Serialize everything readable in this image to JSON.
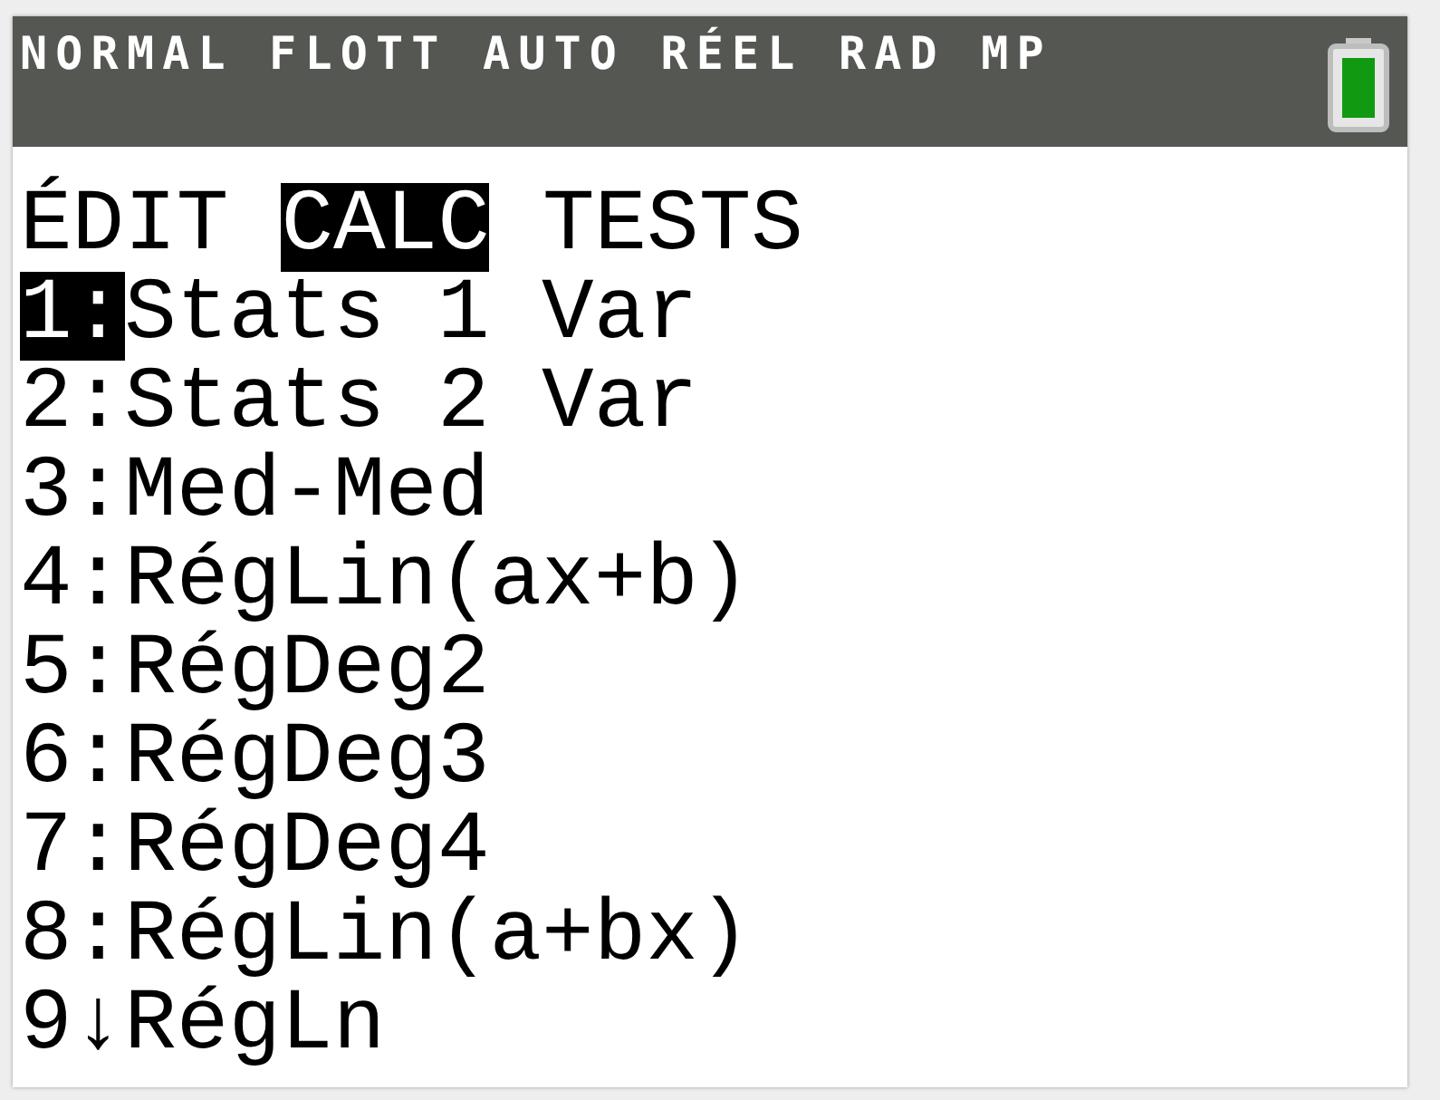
{
  "status_bar": {
    "text": "NORMAL FLOTT AUTO RÉEL RAD MP"
  },
  "tabs": [
    {
      "label": "ÉDIT",
      "selected": false
    },
    {
      "label": "CALC",
      "selected": true
    },
    {
      "label": "TESTS",
      "selected": false
    }
  ],
  "items": [
    {
      "number": "1",
      "separator": ":",
      "label": "Stats 1 Var",
      "selected": true
    },
    {
      "number": "2",
      "separator": ":",
      "label": "Stats 2 Var",
      "selected": false
    },
    {
      "number": "3",
      "separator": ":",
      "label": "Med-Med",
      "selected": false
    },
    {
      "number": "4",
      "separator": ":",
      "label": "RégLin(ax+b)",
      "selected": false
    },
    {
      "number": "5",
      "separator": ":",
      "label": "RégDeg2",
      "selected": false
    },
    {
      "number": "6",
      "separator": ":",
      "label": "RégDeg3",
      "selected": false
    },
    {
      "number": "7",
      "separator": ":",
      "label": "RégDeg4",
      "selected": false
    },
    {
      "number": "8",
      "separator": ":",
      "label": "RégLin(a+bx)",
      "selected": false
    },
    {
      "number": "9",
      "separator": "↓",
      "label": "RégLn",
      "selected": false
    }
  ]
}
